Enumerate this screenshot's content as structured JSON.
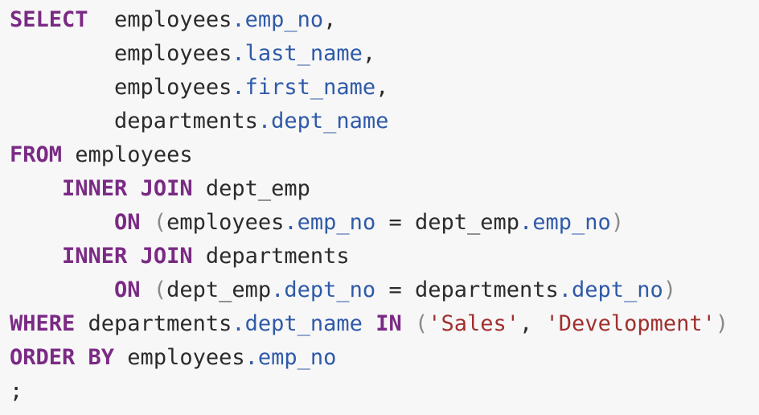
{
  "colors": {
    "background": "#f7f7f7",
    "keyword": "#7a2a84",
    "identifier": "#2b2b2b",
    "field": "#2f5aa8",
    "string": "#a0302e",
    "paren": "#8a8a8a"
  },
  "code": {
    "lines": [
      [
        {
          "t": "SELECT",
          "c": "kw"
        },
        {
          "t": "  employees"
        },
        {
          "t": ".emp_no",
          "c": "field"
        },
        {
          "t": ","
        }
      ],
      [
        {
          "t": "        employees"
        },
        {
          "t": ".last_name",
          "c": "field"
        },
        {
          "t": ","
        }
      ],
      [
        {
          "t": "        employees"
        },
        {
          "t": ".first_name",
          "c": "field"
        },
        {
          "t": ","
        }
      ],
      [
        {
          "t": "        departments"
        },
        {
          "t": ".dept_name",
          "c": "field"
        }
      ],
      [
        {
          "t": "FROM",
          "c": "kw"
        },
        {
          "t": " employees"
        }
      ],
      [
        {
          "t": "    "
        },
        {
          "t": "INNER JOIN",
          "c": "kw"
        },
        {
          "t": " dept_emp"
        }
      ],
      [
        {
          "t": "        "
        },
        {
          "t": "ON",
          "c": "kw"
        },
        {
          "t": " "
        },
        {
          "t": "(",
          "c": "paren"
        },
        {
          "t": "employees"
        },
        {
          "t": ".emp_no",
          "c": "field"
        },
        {
          "t": " = dept_emp"
        },
        {
          "t": ".emp_no",
          "c": "field"
        },
        {
          "t": ")",
          "c": "paren"
        }
      ],
      [
        {
          "t": "    "
        },
        {
          "t": "INNER JOIN",
          "c": "kw"
        },
        {
          "t": " departments"
        }
      ],
      [
        {
          "t": "        "
        },
        {
          "t": "ON",
          "c": "kw"
        },
        {
          "t": " "
        },
        {
          "t": "(",
          "c": "paren"
        },
        {
          "t": "dept_emp"
        },
        {
          "t": ".dept_no",
          "c": "field"
        },
        {
          "t": " = departments"
        },
        {
          "t": ".dept_no",
          "c": "field"
        },
        {
          "t": ")",
          "c": "paren"
        }
      ],
      [
        {
          "t": "WHERE",
          "c": "kw"
        },
        {
          "t": " departments"
        },
        {
          "t": ".dept_name",
          "c": "field"
        },
        {
          "t": " "
        },
        {
          "t": "IN",
          "c": "kw"
        },
        {
          "t": " "
        },
        {
          "t": "(",
          "c": "paren"
        },
        {
          "t": "'Sales'",
          "c": "str"
        },
        {
          "t": ", "
        },
        {
          "t": "'Development'",
          "c": "str"
        },
        {
          "t": ")",
          "c": "paren"
        }
      ],
      [
        {
          "t": "ORDER BY",
          "c": "kw"
        },
        {
          "t": " employees"
        },
        {
          "t": ".emp_no",
          "c": "field"
        }
      ],
      [
        {
          "t": ";"
        }
      ]
    ]
  }
}
